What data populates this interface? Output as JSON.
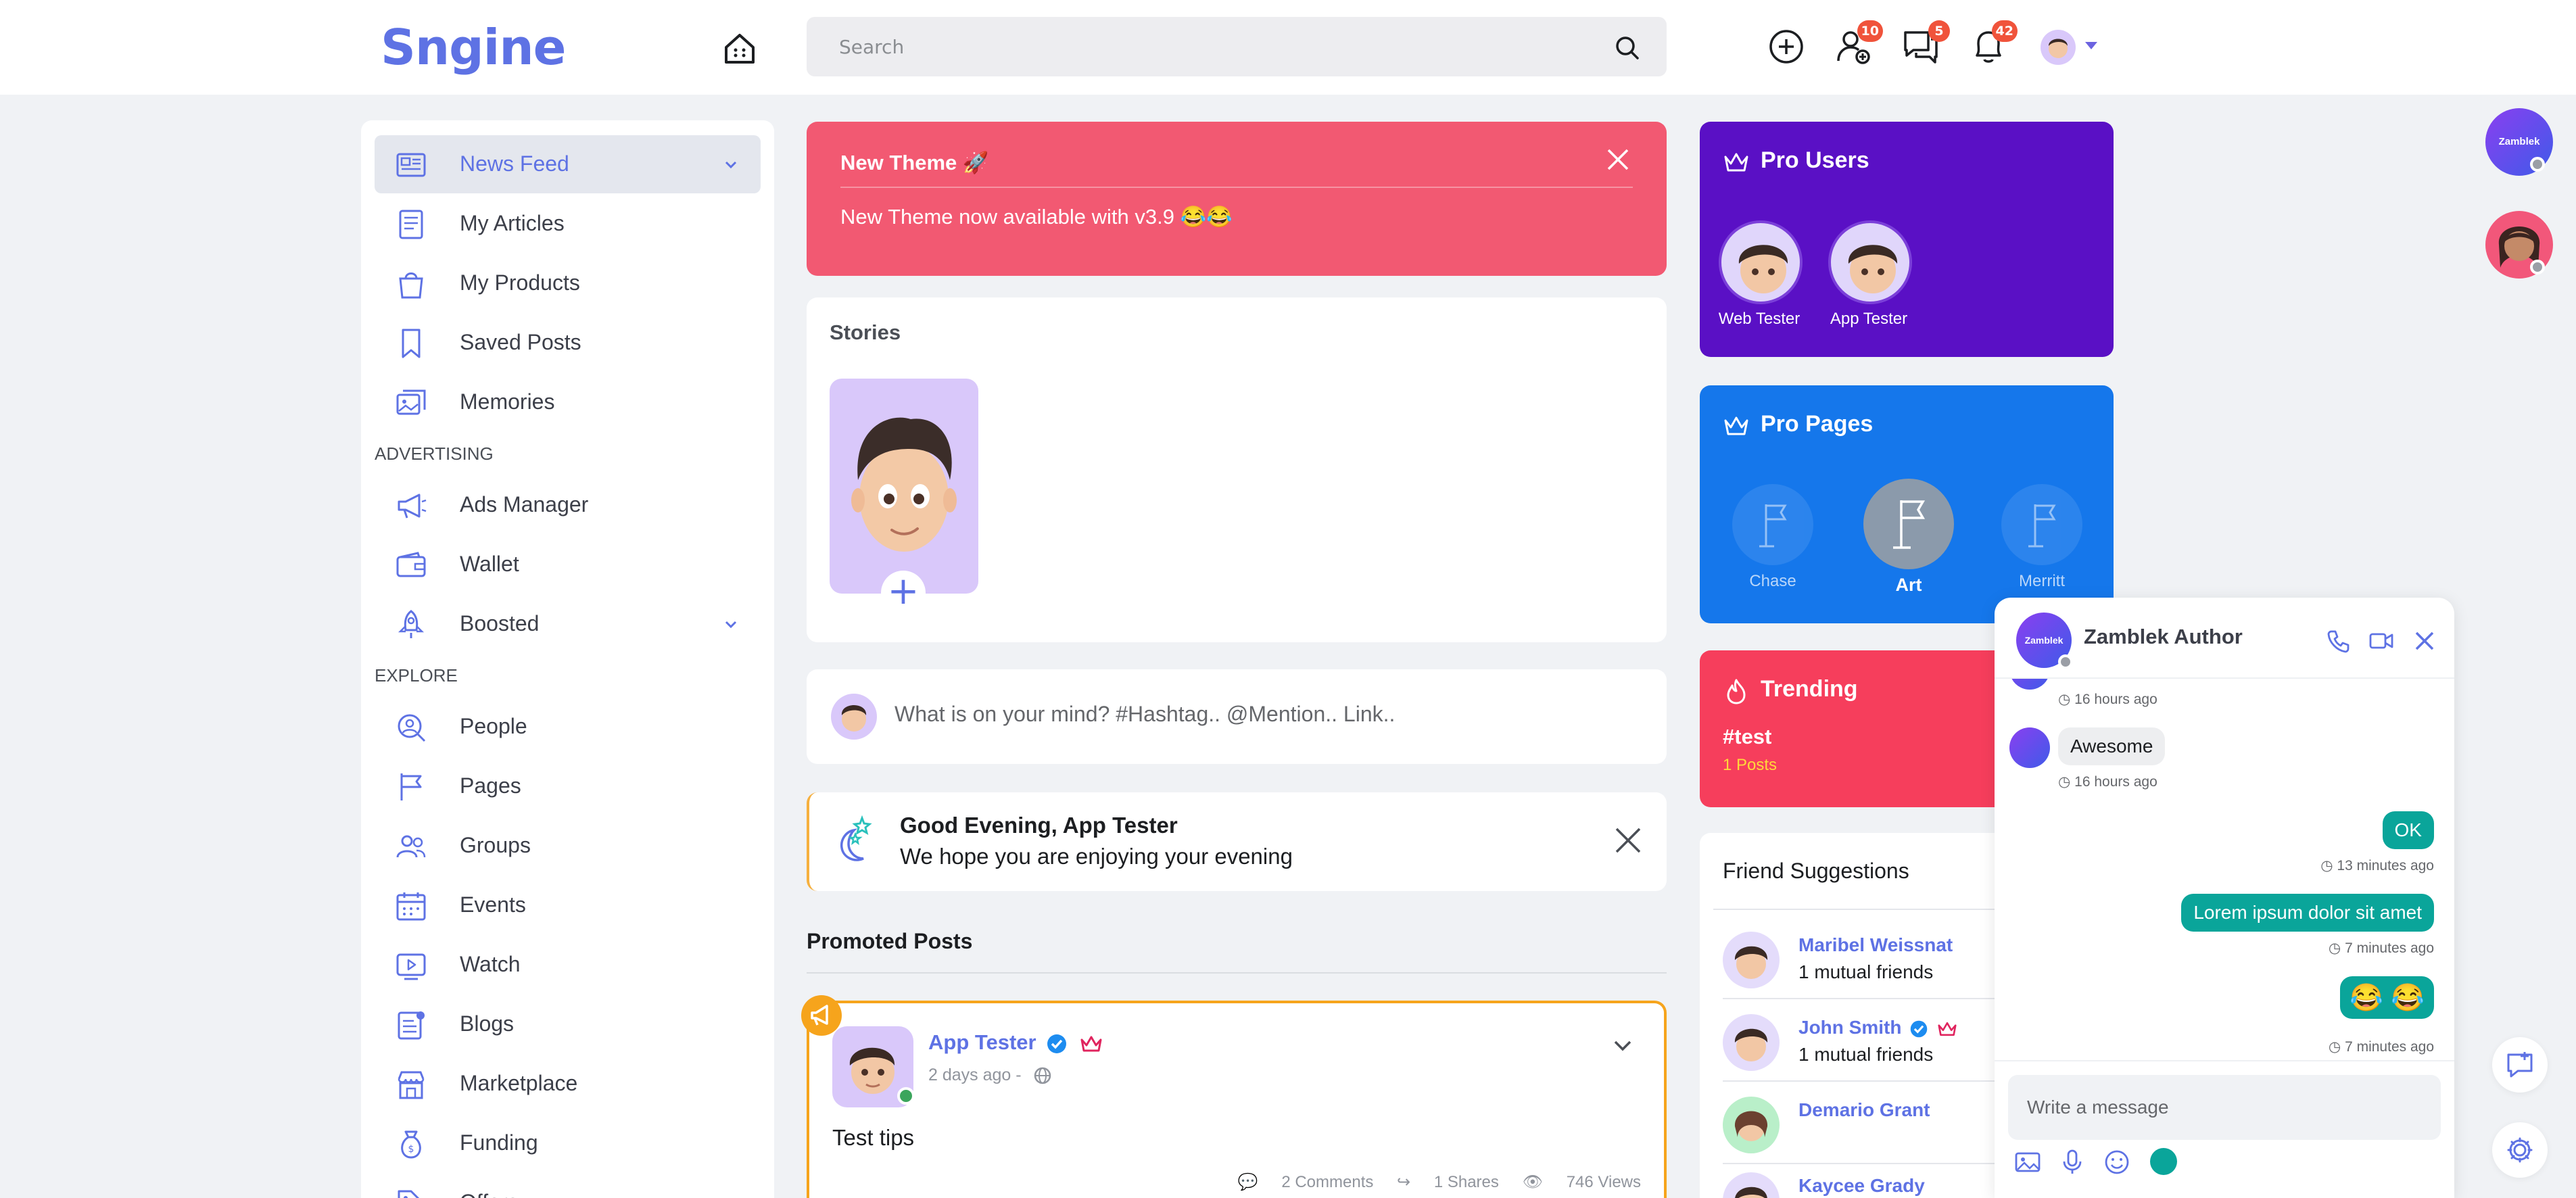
{
  "topbar": {
    "logo": "Sngine",
    "search_placeholder": "Search",
    "badges": {
      "friend_requests": "10",
      "messages": "5",
      "notifications": "42"
    }
  },
  "sidebar": {
    "items": [
      {
        "label": "News Feed"
      },
      {
        "label": "My Articles"
      },
      {
        "label": "My Products"
      },
      {
        "label": "Saved Posts"
      },
      {
        "label": "Memories"
      },
      {
        "label": "Ads Manager"
      },
      {
        "label": "Wallet"
      },
      {
        "label": "Boosted"
      },
      {
        "label": "People"
      },
      {
        "label": "Pages"
      },
      {
        "label": "Groups"
      },
      {
        "label": "Events"
      },
      {
        "label": "Watch"
      },
      {
        "label": "Blogs"
      },
      {
        "label": "Marketplace"
      },
      {
        "label": "Funding"
      },
      {
        "label": "Offers"
      }
    ],
    "sections": {
      "advertising": "ADVERTISING",
      "explore": "EXPLORE"
    }
  },
  "alert": {
    "title": "New Theme 🚀",
    "message": "New Theme now available with v3.9 😂😂"
  },
  "stories": {
    "title": "Stories",
    "add_label": "+"
  },
  "composer": {
    "placeholder": "What is on your mind? #Hashtag.. @Mention.. Link.."
  },
  "greeting": {
    "title": "Good Evening, App Tester",
    "subtitle": "We hope you are enjoying your evening"
  },
  "promoted": {
    "title": "Promoted Posts",
    "post": {
      "author": "App Tester",
      "time": "2 days ago -",
      "text": "Test tips",
      "comments": "2 Comments",
      "shares": "1 Shares",
      "views": "746 Views"
    }
  },
  "pro_users": {
    "title": "Pro Users",
    "users": [
      {
        "name": "Web Tester"
      },
      {
        "name": "App Tester"
      }
    ]
  },
  "pro_pages": {
    "title": "Pro Pages",
    "pages": [
      {
        "name": "Chase"
      },
      {
        "name": "Art"
      },
      {
        "name": "Merritt"
      }
    ]
  },
  "trending": {
    "title": "Trending",
    "tag": "#test",
    "count": "1 Posts"
  },
  "friend_suggestions": {
    "title": "Friend Suggestions",
    "items": [
      {
        "name": "Maribel Weissnat",
        "mutual": "1 mutual friends"
      },
      {
        "name": "John Smith",
        "mutual": "1 mutual friends"
      },
      {
        "name": "Demario Grant",
        "mutual": ""
      },
      {
        "name": "Kaycee Grady",
        "mutual": ""
      }
    ]
  },
  "rail": {
    "zamblek_label": "Zamblek"
  },
  "chat": {
    "name": "Zamblek Author",
    "avatar_text": "Zamblek",
    "messages": [
      {
        "time": "16 hours ago"
      },
      {
        "text": "Awesome",
        "time": "16 hours ago"
      },
      {
        "text": "OK",
        "time": "13 minutes ago"
      },
      {
        "text": "Lorem ipsum dolor sit amet",
        "time": "7 minutes ago"
      },
      {
        "text": "😂 😂",
        "time": "7 minutes ago"
      }
    ],
    "input_placeholder": "Write a message"
  },
  "colors": {
    "accent": "#5e72e4",
    "pro_users_bg": "#5a10c5",
    "pro_pages_bg": "#1577eb",
    "trending_bg": "#f63e5c",
    "alert_bg": "#f25972",
    "chat_out": "#0aa59a"
  }
}
